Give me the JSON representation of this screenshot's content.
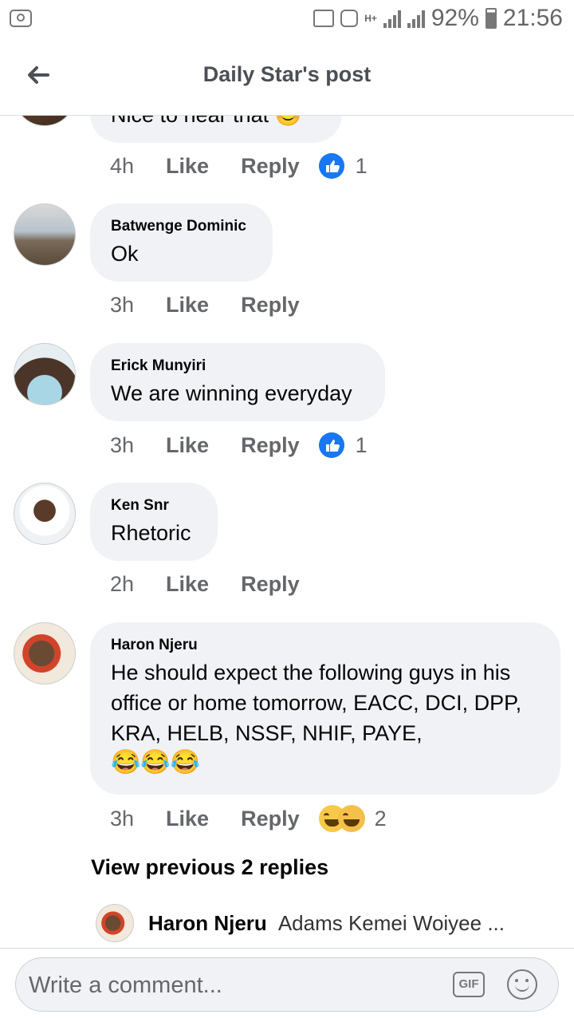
{
  "status": {
    "battery": "92%",
    "time": "21:56",
    "network": "H+"
  },
  "header": {
    "title": "Daily Star's post"
  },
  "comments": [
    {
      "name": "",
      "text": "Nice to hear that 😊",
      "time": "4h",
      "like": "Like",
      "reply": "Reply",
      "reactions": "1"
    },
    {
      "name": "Batwenge Dominic",
      "text": "Ok",
      "time": "3h",
      "like": "Like",
      "reply": "Reply",
      "reactions": ""
    },
    {
      "name": "Erick Munyiri",
      "text": "We are winning everyday",
      "time": "3h",
      "like": "Like",
      "reply": "Reply",
      "reactions": "1"
    },
    {
      "name": "Ken Snr",
      "text": "Rhetoric",
      "time": "2h",
      "like": "Like",
      "reply": "Reply",
      "reactions": ""
    },
    {
      "name": "Haron Njeru",
      "text": "He should expect the following guys in his office or home tomorrow, EACC, DCI, DPP, KRA, HELB, NSSF, NHIF, PAYE,",
      "emoji": "😂😂😂",
      "time": "3h",
      "like": "Like",
      "reply": "Reply",
      "reactions": "2"
    }
  ],
  "view_previous": "View previous 2 replies",
  "reply_preview": {
    "name": "Haron Njeru",
    "text": "Adams Kemei Woiyee ..."
  },
  "composer": {
    "placeholder": "Write a comment...",
    "gif_label": "GIF"
  },
  "colors": {
    "like_blue": "#1877f2",
    "bubble": "#f0f2f5"
  }
}
